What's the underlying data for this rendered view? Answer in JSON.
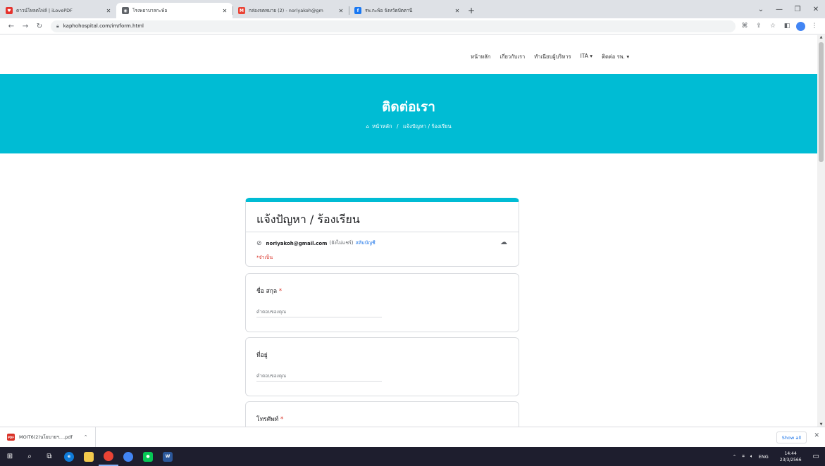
{
  "browser": {
    "tabs": [
      {
        "title": "ดาวน์โหลดไฟล์ | iLovePDF",
        "favicon_color": "#e5322d",
        "active": false
      },
      {
        "title": "โรงพยาบาลกะพ้อ",
        "favicon_color": "#5f6368",
        "active": true
      },
      {
        "title": "กล่องจดหมาย (2) - noriyakoh@gm",
        "favicon_color": "#ea4335",
        "favicon_glyph": "M",
        "active": false
      },
      {
        "title": "รพ.กะพ้อ จังหวัดปัตตานี",
        "favicon_color": "#1877f2",
        "favicon_glyph": "f",
        "active": false
      }
    ],
    "url": "kaphohospital.com/im/form.html"
  },
  "site": {
    "nav": [
      "หน้าหลัก",
      "เกี่ยวกับเรา",
      "ทำเนียบผู้บริหาร",
      "ITA ▾",
      "ติดต่อ รพ. ▾"
    ],
    "hero_title": "ติดต่อเรา",
    "breadcrumb_home": "หน้าหลัก",
    "breadcrumb_sep": "/",
    "breadcrumb_current": "แจ้งปัญหา / ร้องเรียน",
    "accent_color": "#00bcd4"
  },
  "form": {
    "title": "แจ้งปัญหา / ร้องเรียน",
    "account_email": "noriyakoh@gmail.com",
    "account_shared": "(ยังไม่แชร์)",
    "switch_account": "สลับบัญชี",
    "required_note": "*จำเป็น",
    "questions": [
      {
        "label": "ชื่อ สกุล",
        "required": "*",
        "placeholder": "คำตอบของคุณ"
      },
      {
        "label": "ที่อยู่",
        "required": "",
        "placeholder": "คำตอบของคุณ"
      },
      {
        "label": "โทรศัพท์",
        "required": "*",
        "placeholder": ""
      }
    ]
  },
  "downloads": {
    "file_name": "MOIT6(2)นโยบายฯ....pdf",
    "show_all": "Show all"
  },
  "taskbar": {
    "lang": "ENG",
    "time": "14:44",
    "date": "23/3/2566"
  }
}
